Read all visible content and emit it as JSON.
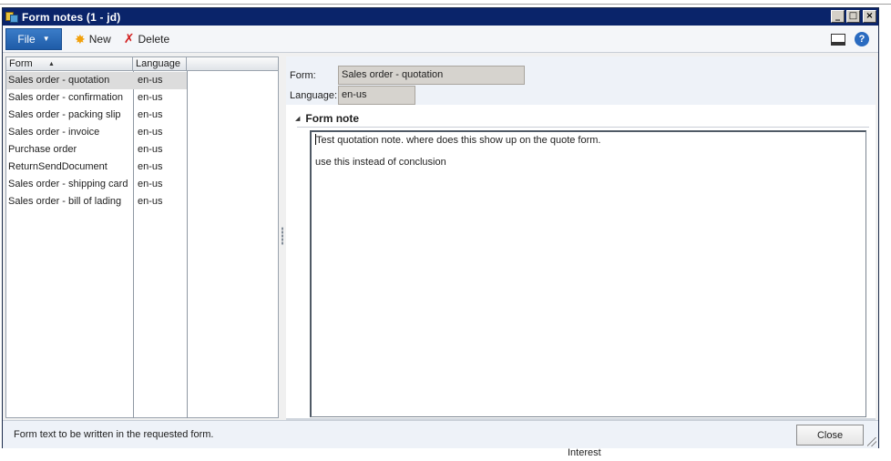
{
  "window": {
    "title": "Form notes (1 - jd)",
    "controls": {
      "minimize": "_",
      "maximize": "□",
      "close": "×"
    }
  },
  "toolbar": {
    "file_label": "File",
    "new_label": "New",
    "delete_label": "Delete",
    "new_icon": "✸",
    "delete_icon": "✗"
  },
  "grid": {
    "columns": {
      "form": "Form",
      "language": "Language"
    },
    "rows": [
      {
        "form": "Sales order - quotation",
        "language": "en-us",
        "selected": true
      },
      {
        "form": "Sales order - confirmation",
        "language": "en-us"
      },
      {
        "form": "Sales order - packing slip",
        "language": "en-us"
      },
      {
        "form": "Sales order - invoice",
        "language": "en-us"
      },
      {
        "form": "Purchase order",
        "language": "en-us"
      },
      {
        "form": "ReturnSendDocument",
        "language": "en-us"
      },
      {
        "form": "Sales order - shipping card",
        "language": "en-us"
      },
      {
        "form": "Sales order - bill of lading",
        "language": "en-us"
      }
    ]
  },
  "detail": {
    "form_label": "Form:",
    "form_value": "Sales order - quotation",
    "language_label": "Language:",
    "language_value": "en-us",
    "section_title": "Form note",
    "note_line1": "Test quotation note.  where does this show up on the quote form.",
    "note_line2": "use this instead of conclusion"
  },
  "statusbar": {
    "text": "Form text to be written in the requested form.",
    "close_label": "Close"
  },
  "background": {
    "label": "Interest"
  },
  "colors": {
    "titlebar": "#0a246a",
    "file_button": "#1f5ca8",
    "selected_row": "#dcdcdc",
    "readonly_field": "#d6d3ce"
  }
}
